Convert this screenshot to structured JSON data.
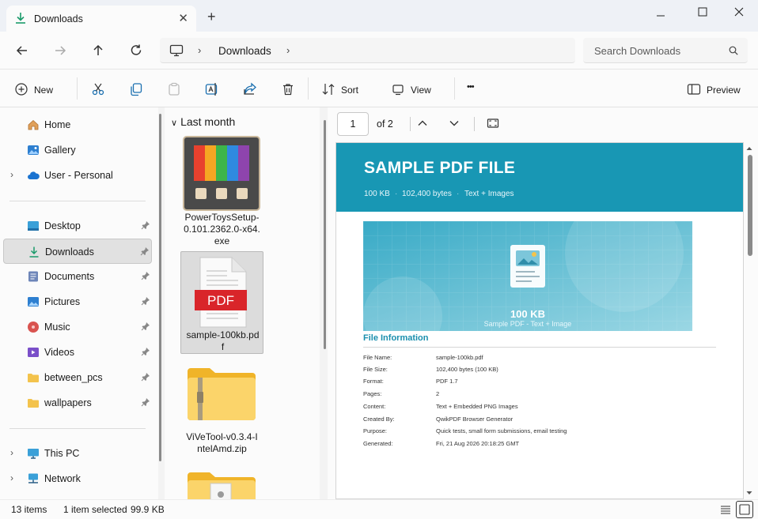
{
  "titlebar": {
    "tab_label": "Downloads",
    "close_tab_icon": "close-icon",
    "new_tab_icon": "plus-icon"
  },
  "nav": {
    "breadcrumb": [
      "Downloads"
    ],
    "search_placeholder": "Search Downloads"
  },
  "commands": {
    "new_label": "New",
    "sort_label": "Sort",
    "view_label": "View",
    "more_label": "•••",
    "preview_label": "Preview"
  },
  "sidebar": {
    "quick": [
      {
        "label": "Home",
        "icon": "home-icon"
      },
      {
        "label": "Gallery",
        "icon": "gallery-icon"
      },
      {
        "label": "User - Personal",
        "icon": "cloud-icon"
      }
    ],
    "pinned": [
      {
        "label": "Desktop",
        "icon": "desktop-icon"
      },
      {
        "label": "Downloads",
        "icon": "download-icon"
      },
      {
        "label": "Documents",
        "icon": "documents-icon"
      },
      {
        "label": "Pictures",
        "icon": "pictures-icon"
      },
      {
        "label": "Music",
        "icon": "music-icon"
      },
      {
        "label": "Videos",
        "icon": "videos-icon"
      },
      {
        "label": "between_pcs",
        "icon": "folder-icon"
      },
      {
        "label": "wallpapers",
        "icon": "folder-icon"
      }
    ],
    "devices": [
      {
        "label": "This PC",
        "icon": "this-pc-icon"
      },
      {
        "label": "Network",
        "icon": "network-icon"
      }
    ]
  },
  "files": {
    "group": "Last month",
    "items": [
      {
        "name_lines": [
          "PowerToysSetup-",
          "0.101.2362.0-x64.",
          "exe"
        ]
      },
      {
        "name_lines": [
          "sample-100kb.pd",
          "f"
        ]
      },
      {
        "name_lines": [
          "ViVeTool-v0.3.4-I",
          "ntelAmd.zip"
        ]
      }
    ]
  },
  "preview": {
    "page": "1",
    "of_pages": "of 2",
    "pdf": {
      "title": "SAMPLE PDF FILE",
      "meta": [
        "100 KB",
        "102,400 bytes",
        "Text + Images"
      ],
      "banner_size": "100 KB",
      "banner_sub": "Sample PDF - Text + Image",
      "info_heading": "File Information",
      "info_rows": [
        {
          "k": "File Name:",
          "v": "sample-100kb.pdf"
        },
        {
          "k": "File Size:",
          "v": "102,400 bytes  (100 KB)"
        },
        {
          "k": "Format:",
          "v": "PDF 1.7"
        },
        {
          "k": "Pages:",
          "v": "2"
        },
        {
          "k": "Content:",
          "v": "Text + Embedded PNG Images"
        },
        {
          "k": "Created By:",
          "v": "QwikPDF Browser Generator"
        },
        {
          "k": "Purpose:",
          "v": "Quick tests, small form submissions, email testing"
        },
        {
          "k": "Generated:",
          "v": "Fri, 21 Aug 2026 20:18:25 GMT"
        }
      ]
    }
  },
  "status": {
    "count": "13 items",
    "selected": "1 item selected",
    "size": "99.9 KB"
  },
  "colors": {
    "pdf_header": "#1897b4",
    "accent": "#0067c0"
  }
}
